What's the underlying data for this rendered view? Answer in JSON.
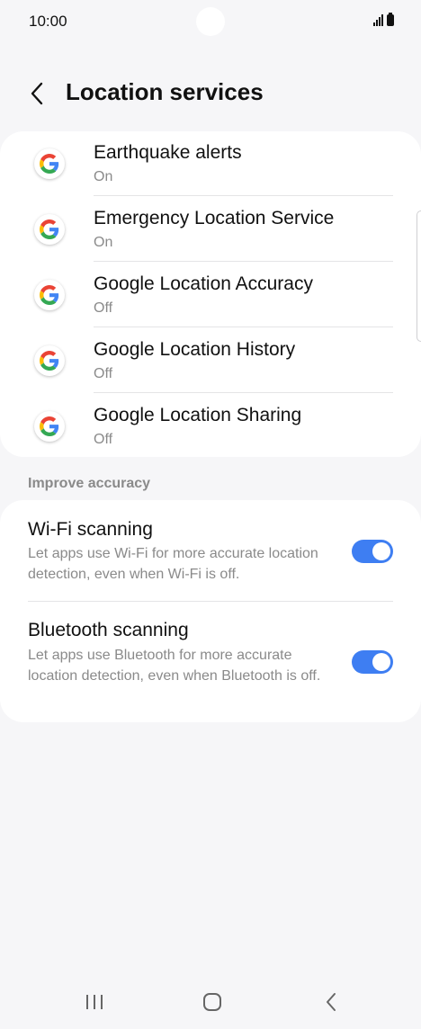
{
  "status_bar": {
    "time": "10:00"
  },
  "header": {
    "title": "Location services"
  },
  "apps": [
    {
      "title": "Earthquake alerts",
      "status": "On"
    },
    {
      "title": "Emergency Location Service",
      "status": "On"
    },
    {
      "title": "Google Location Accuracy",
      "status": "Off"
    },
    {
      "title": "Google Location History",
      "status": "Off"
    },
    {
      "title": "Google Location Sharing",
      "status": "Off"
    }
  ],
  "improve_accuracy": {
    "section_label": "Improve accuracy",
    "wifi": {
      "title": "Wi-Fi scanning",
      "description": "Let apps use Wi-Fi for more accurate location detection, even when Wi-Fi is off.",
      "enabled": true
    },
    "bluetooth": {
      "title": "Bluetooth scanning",
      "description": "Let apps use Bluetooth for more accurate location detection, even when Bluetooth is off.",
      "enabled": true
    }
  },
  "colors": {
    "accent": "#3e7ef2",
    "background": "#f6f6f8",
    "card": "#ffffff",
    "secondary_text": "#8a8a8a"
  },
  "icons": [
    "back-arrow-icon",
    "google-g-icon",
    "signal-icon",
    "battery-icon",
    "recent-apps-icon",
    "home-icon",
    "back-icon"
  ]
}
